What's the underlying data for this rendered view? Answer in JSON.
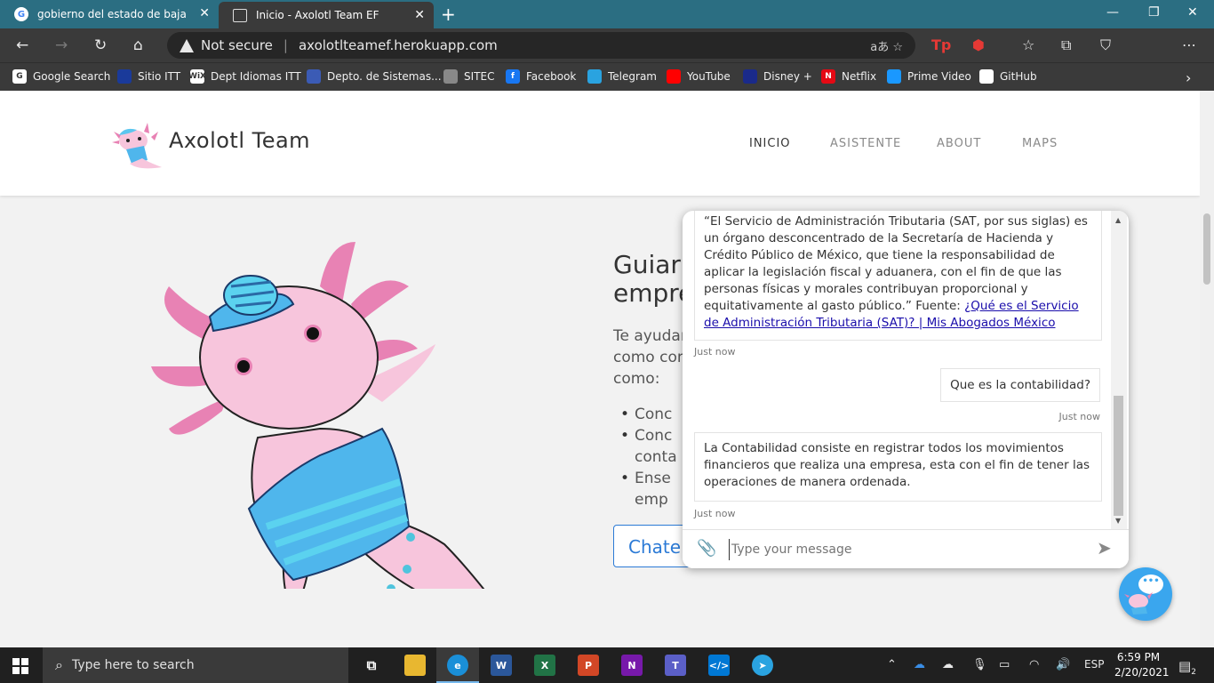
{
  "browser": {
    "tabs": [
      {
        "title": "gobierno del estado de baja calif",
        "favicon": "G"
      },
      {
        "title": "Inicio - Axolotl Team EF",
        "favicon": ""
      }
    ],
    "security_label": "Not secure",
    "url": "axolotlteamef.herokuapp.com",
    "bookmarks": [
      {
        "label": "Google Search",
        "icon": "G",
        "color": "#ffffff"
      },
      {
        "label": "Sitio ITT",
        "icon": "",
        "color": "#1a3a9a"
      },
      {
        "label": "Dept Idiomas ITT",
        "icon": "WiX",
        "color": "#ffffff"
      },
      {
        "label": "Depto. de Sistemas...",
        "icon": "",
        "color": "#3b5bb5"
      },
      {
        "label": "SITEC",
        "icon": "",
        "color": "#888888"
      },
      {
        "label": "Facebook",
        "icon": "f",
        "color": "#1877f2"
      },
      {
        "label": "Telegram",
        "icon": "",
        "color": "#2aa3e0"
      },
      {
        "label": "YouTube",
        "icon": "",
        "color": "#ff0000"
      },
      {
        "label": "Disney +",
        "icon": "",
        "color": "#1a2a8a"
      },
      {
        "label": "Netflix",
        "icon": "N",
        "color": "#e50914"
      },
      {
        "label": "Prime Video",
        "icon": "",
        "color": "#1a98ff"
      },
      {
        "label": "GitHub",
        "icon": "",
        "color": "#ffffff"
      }
    ]
  },
  "site": {
    "brand": "Axolotl Team",
    "nav": [
      "INICIO",
      "ASISTENTE",
      "ABOUT",
      "MAPS"
    ],
    "hero_title_line1": "Guiar",
    "hero_title_line2": "empre",
    "hero_text_line1": "Te ayudar",
    "hero_text_line2": "como con",
    "hero_text_line3": "como:",
    "bullets": [
      "Conc",
      "Conc",
      "conta",
      "Ense",
      "emp"
    ],
    "chat_button": "Chate"
  },
  "chat": {
    "messages": [
      {
        "type": "bot",
        "text": "“El Servicio de Administración Tributaria (SAT, por sus siglas) es un órgano desconcentrado de la Secretaría de Hacienda y Crédito Público de México, que tiene la responsabilidad de aplicar la legislación fiscal y aduanera, con el fin de que las personas físicas y morales contribuyan proporcional y equitativamente al gasto público.” Fuente: ",
        "link": "¿Qué es el Servicio de Administración Tributaria (SAT)? | Mis Abogados México",
        "time": "Just now"
      },
      {
        "type": "user",
        "text": "Que es la contabilidad?",
        "time": "Just now"
      },
      {
        "type": "bot",
        "text": "La Contabilidad consiste en registrar todos los movimientos financieros que realiza una empresa, esta con el fin de tener las operaciones de manera ordenada.",
        "time": "Just now"
      }
    ],
    "input_placeholder": "Type your message"
  },
  "taskbar": {
    "search_placeholder": "Type here to search",
    "language": "ESP",
    "time": "6:59 PM",
    "date": "2/20/2021",
    "notifications": "2"
  }
}
